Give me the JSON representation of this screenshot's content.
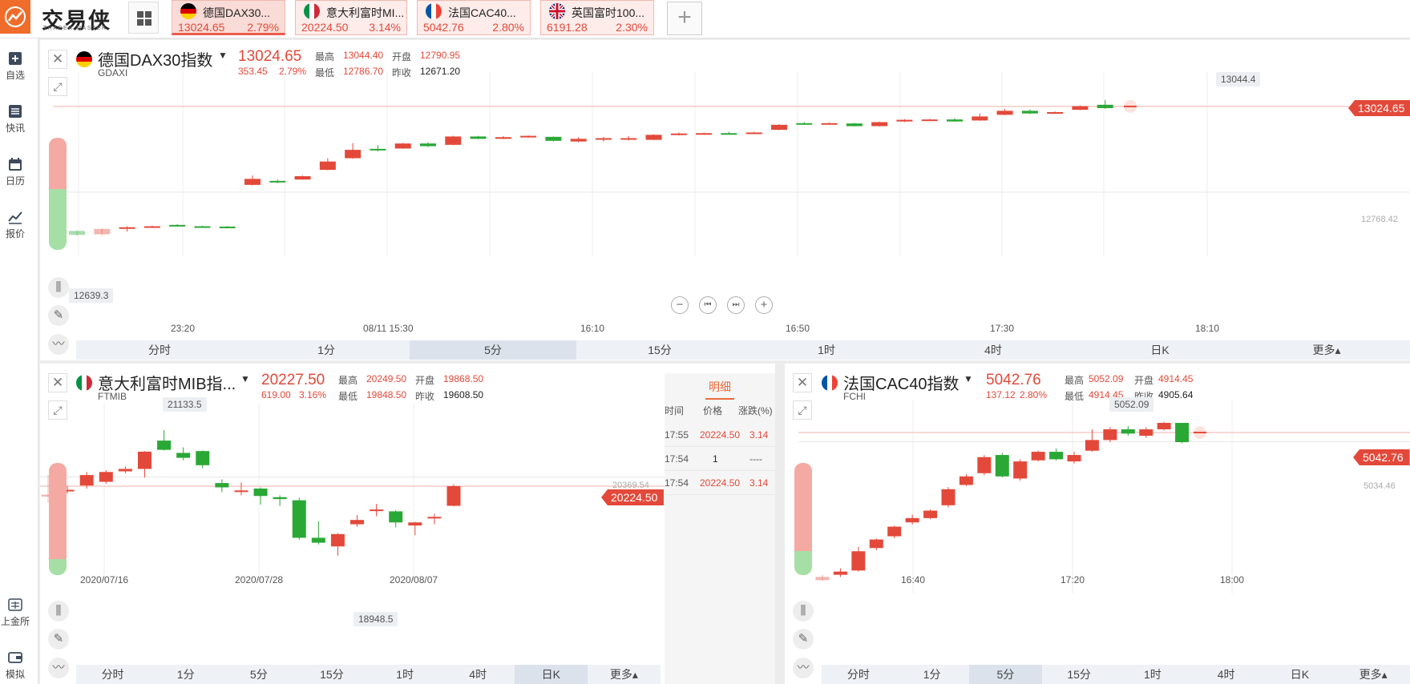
{
  "app": {
    "logo_text": "交易侠",
    "logo_sub": "TRADER MASTER",
    "add_tab": "+"
  },
  "tabs": [
    {
      "name": "德国DAX30...",
      "price": "13024.65",
      "pct": "2.79%",
      "active": true
    },
    {
      "name": "意大利富时MI...",
      "price": "20224.50",
      "pct": "3.14%",
      "active": false
    },
    {
      "name": "法国CAC40...",
      "price": "5042.76",
      "pct": "2.80%",
      "active": false
    },
    {
      "name": "英国富时100...",
      "price": "6191.28",
      "pct": "2.30%",
      "active": false
    }
  ],
  "nav": {
    "fav": "自选",
    "news": "快讯",
    "calendar": "日历",
    "quote": "报价",
    "gold": "上金所",
    "sim": "模拟"
  },
  "labels": {
    "high": "最高",
    "low": "最低",
    "open": "开盘",
    "prev": "昨收"
  },
  "intervals_top": [
    "分时",
    "1分",
    "5分",
    "15分",
    "1时",
    "4时",
    "日K",
    "更多▴"
  ],
  "intervals_sm": [
    "分时",
    "1分",
    "5分",
    "15分",
    "1时",
    "4时",
    "日K",
    "更多▴"
  ],
  "dax": {
    "name": "德国DAX30指数",
    "code": "GDAXI",
    "price": "13024.65",
    "chg": "353.45",
    "pct": "2.79%",
    "high": "13044.40",
    "low": "12786.70",
    "open": "12790.95",
    "prev": "12671.20",
    "max_label": "13044.4",
    "min_label": "12639.3",
    "ref_label": "12768.42",
    "x_labels": [
      "23:20",
      "08/11 15:30",
      "16:10",
      "16:50",
      "17:30",
      "18:10"
    ],
    "selected_interval": 2
  },
  "mib": {
    "name": "意大利富时MIB指...",
    "code": "FTMIB",
    "price": "20227.50",
    "chg": "619.00",
    "pct": "3.16%",
    "high": "20249.50",
    "low": "19848.50",
    "open": "19868.50",
    "prev": "19608.50",
    "max_label": "21133.5",
    "min_label": "18948.5",
    "ref_label": "20369.54",
    "flag_price": "20224.50",
    "x_labels": [
      "2020/07/16",
      "2020/07/28",
      "2020/08/07"
    ],
    "selected_interval": 6
  },
  "cac": {
    "name": "法国CAC40指数",
    "code": "FCHI",
    "price": "5042.76",
    "chg": "137.12",
    "pct": "2.80%",
    "high": "5052.09",
    "low": "4914.45",
    "open": "4914.45",
    "prev": "4905.64",
    "max_label": "5052.09",
    "ref_label": "5034.46",
    "flag_price": "5042.76",
    "x_labels": [
      "16:40",
      "17:20",
      "18:00"
    ],
    "selected_interval": 2
  },
  "detail": {
    "title": "明细",
    "headers": [
      "时间",
      "价格",
      "涨跌(%)"
    ],
    "rows": [
      {
        "time": "17:55",
        "price": "20224.50",
        "chg": "3.14"
      },
      {
        "time": "17:54",
        "price": "1",
        "chg": "----"
      },
      {
        "time": "17:54",
        "price": "20224.50",
        "chg": "3.14"
      }
    ]
  },
  "colors": {
    "up": "#e3493a",
    "down": "#2aa836",
    "accent": "#ef6c2b"
  },
  "chart_data": [
    {
      "type": "candlestick",
      "title": "德国DAX30指数",
      "x": [
        "23:20",
        "08/11 15:30",
        "16:10",
        "16:50",
        "17:30",
        "18:10"
      ],
      "ylim": [
        12600,
        13080
      ],
      "candles": [
        {
          "o": 12652,
          "c": 12640,
          "h": 12654,
          "l": 12638,
          "faded": true
        },
        {
          "o": 12642,
          "c": 12658,
          "h": 12660,
          "l": 12639,
          "faded": true
        },
        {
          "o": 12660,
          "c": 12663,
          "h": 12666,
          "l": 12650
        },
        {
          "o": 12664,
          "c": 12666,
          "h": 12668,
          "l": 12662
        },
        {
          "o": 12670,
          "c": 12669,
          "h": 12672,
          "l": 12666
        },
        {
          "o": 12666,
          "c": 12665,
          "h": 12668,
          "l": 12664
        },
        {
          "o": 12665,
          "c": 12663,
          "h": 12667,
          "l": 12661
        },
        {
          "o": 12790,
          "c": 12808,
          "h": 12818,
          "l": 12788
        },
        {
          "o": 12802,
          "c": 12798,
          "h": 12806,
          "l": 12795
        },
        {
          "o": 12806,
          "c": 12816,
          "h": 12818,
          "l": 12805
        },
        {
          "o": 12835,
          "c": 12860,
          "h": 12870,
          "l": 12834
        },
        {
          "o": 12870,
          "c": 12895,
          "h": 12915,
          "l": 12868
        },
        {
          "o": 12898,
          "c": 12894,
          "h": 12909,
          "l": 12890
        },
        {
          "o": 12899,
          "c": 12914,
          "h": 12916,
          "l": 12898
        },
        {
          "o": 12914,
          "c": 12906,
          "h": 12918,
          "l": 12903
        },
        {
          "o": 12910,
          "c": 12935,
          "h": 12937,
          "l": 12909
        },
        {
          "o": 12935,
          "c": 12928,
          "h": 12937,
          "l": 12927
        },
        {
          "o": 12928,
          "c": 12933,
          "h": 12936,
          "l": 12927
        },
        {
          "o": 12934,
          "c": 12937,
          "h": 12938,
          "l": 12931
        },
        {
          "o": 12934,
          "c": 12922,
          "h": 12935,
          "l": 12920
        },
        {
          "o": 12920,
          "c": 12928,
          "h": 12933,
          "l": 12918
        },
        {
          "o": 12930,
          "c": 12930,
          "h": 12934,
          "l": 12920
        },
        {
          "o": 12930,
          "c": 12930,
          "h": 12936,
          "l": 12923
        },
        {
          "o": 12925,
          "c": 12940,
          "h": 12942,
          "l": 12924
        },
        {
          "o": 12940,
          "c": 12944,
          "h": 12947,
          "l": 12938
        },
        {
          "o": 12943,
          "c": 12945,
          "h": 12947,
          "l": 12941
        },
        {
          "o": 12945,
          "c": 12944,
          "h": 12949,
          "l": 12943
        },
        {
          "o": 12943,
          "c": 12947,
          "h": 12949,
          "l": 12942
        },
        {
          "o": 12955,
          "c": 12970,
          "h": 12972,
          "l": 12954
        },
        {
          "o": 12975,
          "c": 12972,
          "h": 12978,
          "l": 12970
        },
        {
          "o": 12973,
          "c": 12975,
          "h": 12977,
          "l": 12972
        },
        {
          "o": 12974,
          "c": 12966,
          "h": 12976,
          "l": 12965
        },
        {
          "o": 12966,
          "c": 12978,
          "h": 12980,
          "l": 12965
        },
        {
          "o": 12980,
          "c": 12985,
          "h": 12987,
          "l": 12978
        },
        {
          "o": 12985,
          "c": 12986,
          "h": 12988,
          "l": 12983
        },
        {
          "o": 12986,
          "c": 12980,
          "h": 12990,
          "l": 12979
        },
        {
          "o": 12983,
          "c": 12995,
          "h": 13004,
          "l": 12982
        },
        {
          "o": 13000,
          "c": 13012,
          "h": 13018,
          "l": 12998
        },
        {
          "o": 13012,
          "c": 13004,
          "h": 13016,
          "l": 13002
        },
        {
          "o": 13004,
          "c": 13008,
          "h": 13010,
          "l": 13003
        },
        {
          "o": 13015,
          "c": 13026,
          "h": 13028,
          "l": 13014
        },
        {
          "o": 13030,
          "c": 13020,
          "h": 13044,
          "l": 13018
        },
        {
          "o": 13024,
          "c": 13025,
          "h": 13026,
          "l": 13023,
          "live": true
        }
      ]
    },
    {
      "type": "candlestick",
      "title": "意大利富时MIB指...",
      "x": [
        "2020/07/16",
        "2020/07/28",
        "2020/08/07"
      ],
      "ylim": [
        18800,
        21300
      ],
      "candles": [
        {
          "o": 20050,
          "c": 20080,
          "h": 20400,
          "l": 19950,
          "faded": true
        },
        {
          "o": 20140,
          "c": 20160,
          "h": 20220,
          "l": 20100
        },
        {
          "o": 20230,
          "c": 20400,
          "h": 20450,
          "l": 20180
        },
        {
          "o": 20290,
          "c": 20450,
          "h": 20480,
          "l": 20260
        },
        {
          "o": 20460,
          "c": 20500,
          "h": 20540,
          "l": 20430
        },
        {
          "o": 20500,
          "c": 20780,
          "h": 20790,
          "l": 20360
        },
        {
          "o": 20960,
          "c": 20810,
          "h": 21133,
          "l": 20800
        },
        {
          "o": 20760,
          "c": 20680,
          "h": 20850,
          "l": 20640
        },
        {
          "o": 20790,
          "c": 20560,
          "h": 20800,
          "l": 20510
        },
        {
          "o": 20270,
          "c": 20200,
          "h": 20330,
          "l": 20120
        },
        {
          "o": 20150,
          "c": 20150,
          "h": 20280,
          "l": 20070
        },
        {
          "o": 20180,
          "c": 20060,
          "h": 20200,
          "l": 19920
        },
        {
          "o": 20040,
          "c": 20010,
          "h": 20070,
          "l": 19900
        },
        {
          "o": 19990,
          "c": 19380,
          "h": 20030,
          "l": 19350
        },
        {
          "o": 19380,
          "c": 19300,
          "h": 19650,
          "l": 19270
        },
        {
          "o": 19240,
          "c": 19440,
          "h": 19460,
          "l": 19090
        },
        {
          "o": 19600,
          "c": 19670,
          "h": 19750,
          "l": 19560
        },
        {
          "o": 19840,
          "c": 19840,
          "h": 19930,
          "l": 19730
        },
        {
          "o": 19810,
          "c": 19630,
          "h": 19830,
          "l": 19550
        },
        {
          "o": 19580,
          "c": 19630,
          "h": 19640,
          "l": 19420
        },
        {
          "o": 19720,
          "c": 19720,
          "h": 19770,
          "l": 19600
        },
        {
          "o": 19900,
          "c": 20220,
          "h": 20250,
          "l": 19890
        }
      ]
    },
    {
      "type": "candlestick",
      "title": "法国CAC40指数",
      "x": [
        "16:40",
        "17:20",
        "18:00"
      ],
      "ylim": [
        4900,
        5058
      ],
      "candles": [
        {
          "o": 4905,
          "c": 4908,
          "h": 4910,
          "l": 4904,
          "faded": true
        },
        {
          "o": 4910,
          "c": 4913,
          "h": 4916,
          "l": 4908
        },
        {
          "o": 4914,
          "c": 4932,
          "h": 4936,
          "l": 4913
        },
        {
          "o": 4935,
          "c": 4943,
          "h": 4944,
          "l": 4933
        },
        {
          "o": 4946,
          "c": 4955,
          "h": 4956,
          "l": 4944
        },
        {
          "o": 4959,
          "c": 4963,
          "h": 4966,
          "l": 4957
        },
        {
          "o": 4963,
          "c": 4970,
          "h": 4971,
          "l": 4962
        },
        {
          "o": 4975,
          "c": 4990,
          "h": 4992,
          "l": 4973
        },
        {
          "o": 4994,
          "c": 5002,
          "h": 5004,
          "l": 4993
        },
        {
          "o": 5005,
          "c": 5020,
          "h": 5022,
          "l": 5003
        },
        {
          "o": 5022,
          "c": 5002,
          "h": 5024,
          "l": 5001
        },
        {
          "o": 5000,
          "c": 5016,
          "h": 5018,
          "l": 4998
        },
        {
          "o": 5017,
          "c": 5025,
          "h": 5026,
          "l": 5016
        },
        {
          "o": 5025,
          "c": 5018,
          "h": 5028,
          "l": 5017
        },
        {
          "o": 5016,
          "c": 5022,
          "h": 5025,
          "l": 5014
        },
        {
          "o": 5026,
          "c": 5036,
          "h": 5046,
          "l": 5025
        },
        {
          "o": 5036,
          "c": 5046,
          "h": 5048,
          "l": 5034
        },
        {
          "o": 5046,
          "c": 5042,
          "h": 5049,
          "l": 5040
        },
        {
          "o": 5040,
          "c": 5046,
          "h": 5048,
          "l": 5038
        },
        {
          "o": 5046,
          "c": 5052,
          "h": 5053,
          "l": 5045
        },
        {
          "o": 5052,
          "c": 5034,
          "h": 5052,
          "l": 5033
        },
        {
          "o": 5042,
          "c": 5043,
          "h": 5044,
          "l": 5041,
          "live": true
        }
      ]
    }
  ]
}
